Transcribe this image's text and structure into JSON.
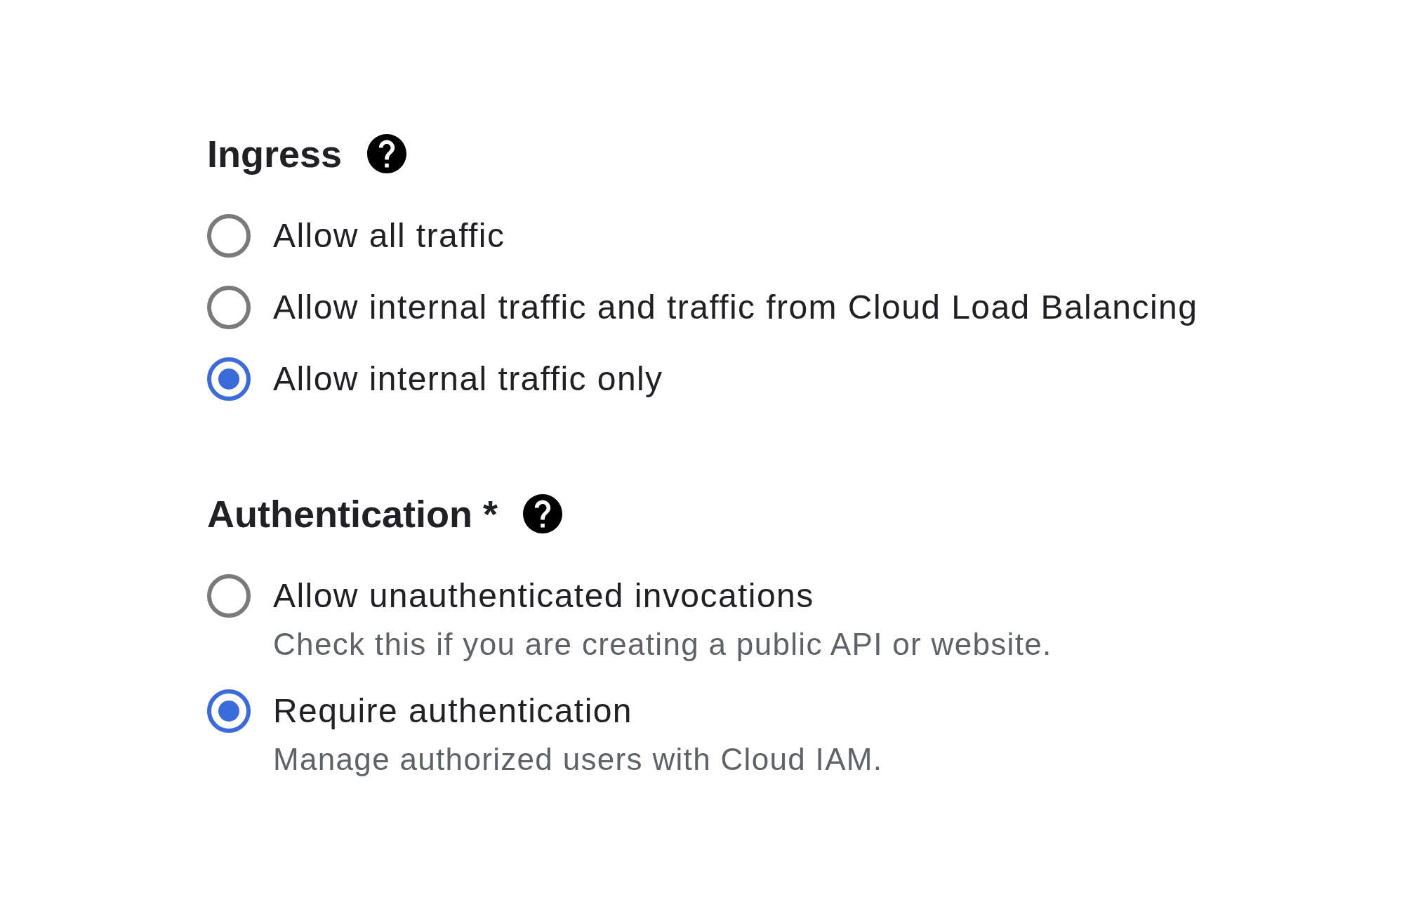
{
  "sections": [
    {
      "title": "Ingress",
      "options": [
        {
          "label": "Allow all traffic",
          "selected": false
        },
        {
          "label": "Allow internal traffic and traffic from Cloud Load Balancing",
          "selected": false
        },
        {
          "label": "Allow internal traffic only",
          "selected": true
        }
      ]
    },
    {
      "title": "Authentication *",
      "options": [
        {
          "label": "Allow unauthenticated invocations",
          "description": "Check this if you are creating a public API or website.",
          "selected": false
        },
        {
          "label": "Require authentication",
          "description": "Manage authorized users with Cloud IAM.",
          "selected": true
        }
      ]
    }
  ]
}
